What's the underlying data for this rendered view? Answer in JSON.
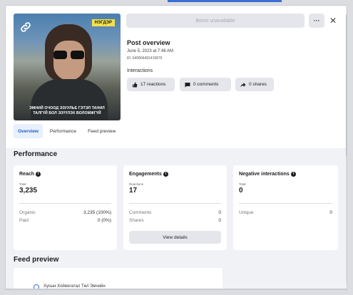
{
  "header": {
    "boost_label": "Boost unavailable",
    "more_label": "···",
    "close_label": "✕"
  },
  "thumbnail": {
    "badge": "HЭГДЭР",
    "caption_line1": "ЭМНИЙ ОЧООД ЭЗУУЛЬЕ ГЭТЭЛ ТАНИЛ",
    "caption_line2": "ТАЛГҮЙ БОЛ ЭЗҮҮЛЭХ ВОЛОМЖГҮЙ"
  },
  "post": {
    "title": "Post overview",
    "date": "June 5, 2023 at 7:46 AM",
    "id": "ID: 640804491415876",
    "interactions_label": "Interactions",
    "reactions": "17 reactions",
    "comments": "0 comments",
    "shares": "0 shares"
  },
  "tabs": [
    {
      "label": "Overview",
      "active": true
    },
    {
      "label": "Performance",
      "active": false
    },
    {
      "label": "Feed preview",
      "active": false
    }
  ],
  "performance": {
    "title": "Performance",
    "reach": {
      "title": "Reach",
      "sub": "Total",
      "value": "3,235",
      "rows": [
        {
          "label": "Organic",
          "value": "3,235 (100%)"
        },
        {
          "label": "Paid",
          "value": "0 (0%)"
        }
      ]
    },
    "engagements": {
      "title": "Engagements",
      "sub": "Reactions",
      "value": "17",
      "rows": [
        {
          "label": "Comments",
          "value": "0"
        },
        {
          "label": "Shares",
          "value": "0"
        }
      ],
      "button": "View details"
    },
    "negative": {
      "title": "Negative interactions",
      "sub": "Total",
      "value": "0",
      "rows": [
        {
          "label": "Unique",
          "value": "0"
        }
      ]
    }
  },
  "feed_preview": {
    "title": "Feed preview",
    "page_name": "Хусын Хоймзгатал Төл Эмчийн"
  },
  "colors": {
    "accent": "#1b5fc9",
    "background": "#f0f2f5",
    "card": "#ffffff"
  }
}
